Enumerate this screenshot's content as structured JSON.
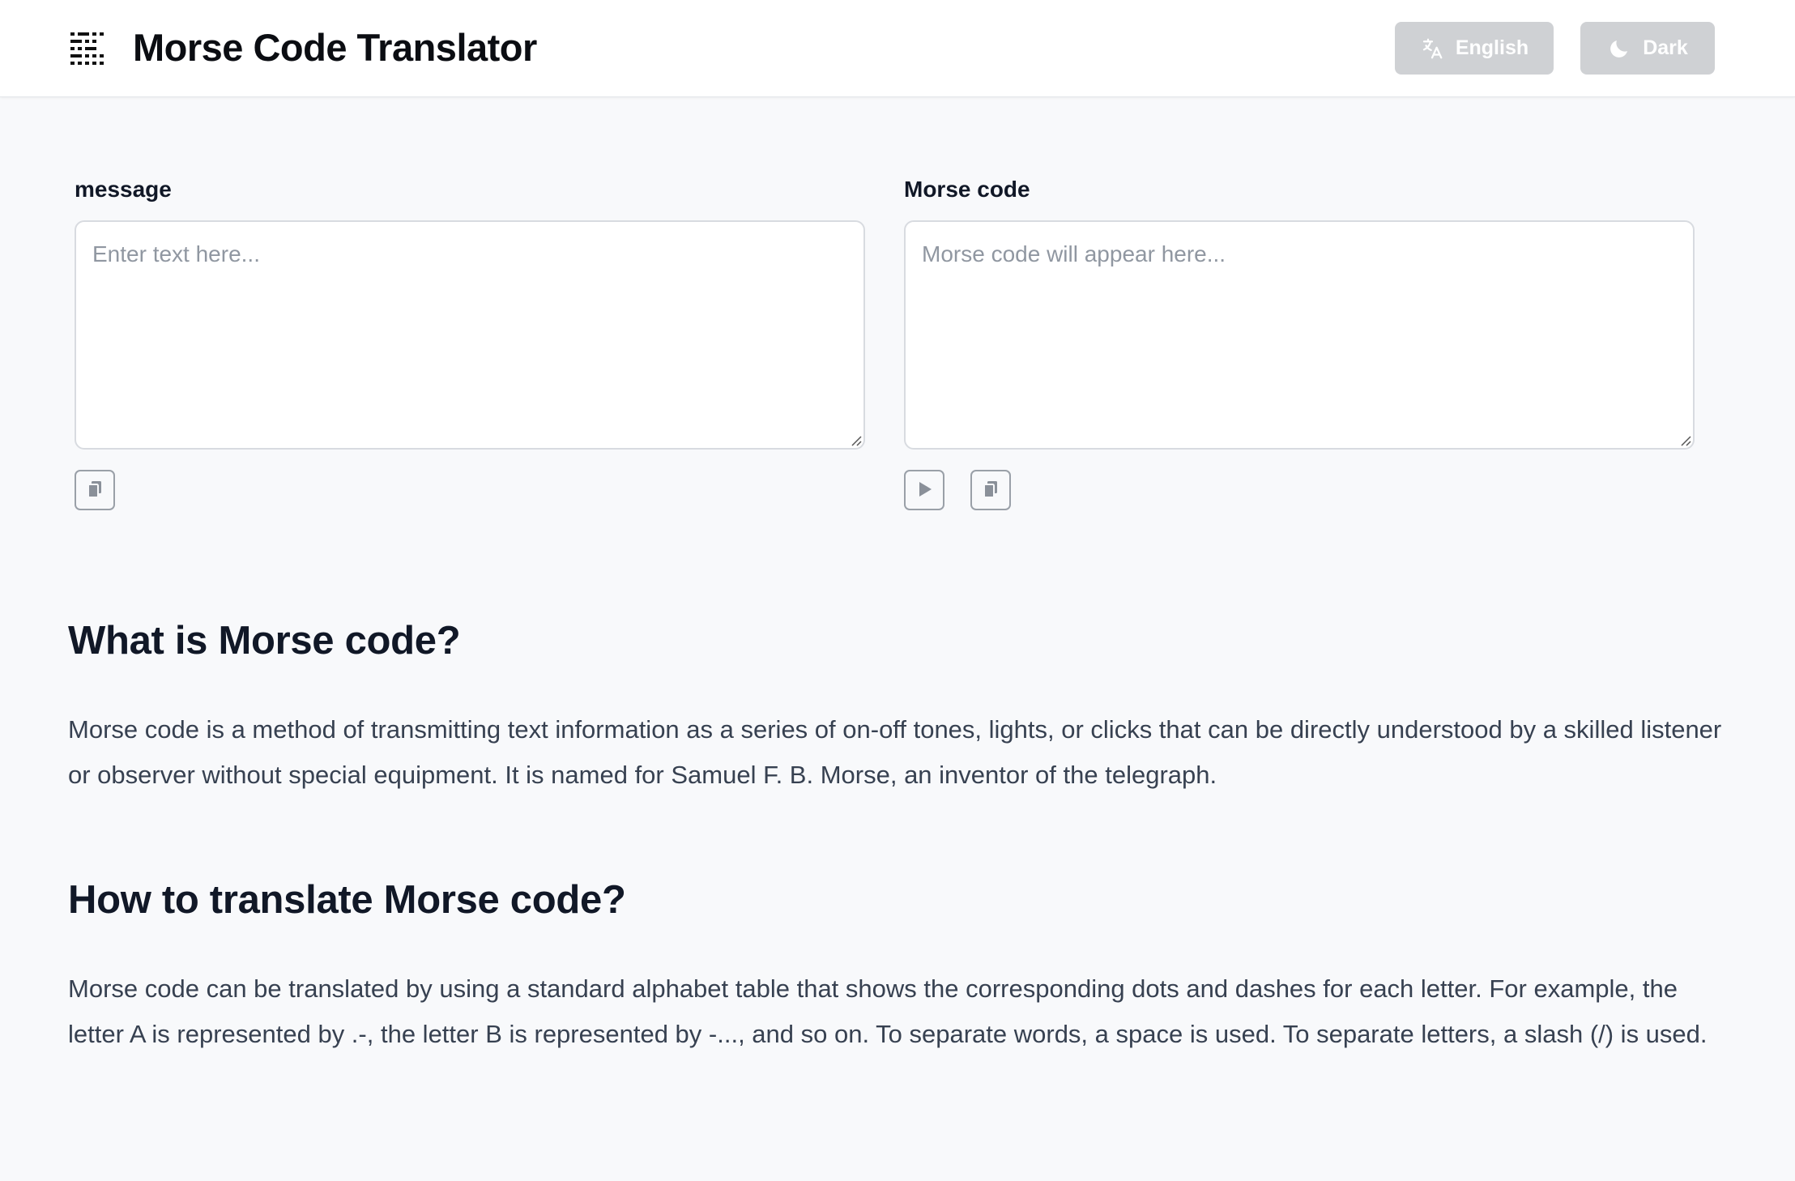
{
  "header": {
    "title": "Morse Code Translator",
    "language_label": "English",
    "theme_label": "Dark"
  },
  "colors": {
    "header_button_bg": "#cfd1d4",
    "page_bg": "#f8f9fb",
    "text_dark": "#111827"
  },
  "icons": {
    "logo": "morse-grid-icon",
    "language": "translate-icon",
    "theme": "moon-icon",
    "copy": "copy-icon",
    "play": "play-icon"
  },
  "input_panel": {
    "label": "message",
    "placeholder": "Enter text here...",
    "value": ""
  },
  "output_panel": {
    "label": "Morse code",
    "placeholder": "Morse code will appear here...",
    "value": ""
  },
  "sections": [
    {
      "title": "What is Morse code?",
      "body": "Morse code is a method of transmitting text information as a series of on-off tones, lights, or clicks that can be directly understood by a skilled listener or observer without special equipment. It is named for Samuel F. B. Morse, an inventor of the telegraph."
    },
    {
      "title": "How to translate Morse code?",
      "body": "Morse code can be translated by using a standard alphabet table that shows the corresponding dots and dashes for each letter. For example, the letter A is represented by .-, the letter B is represented by -..., and so on. To separate words, a space is used. To separate letters, a slash (/) is used."
    }
  ]
}
